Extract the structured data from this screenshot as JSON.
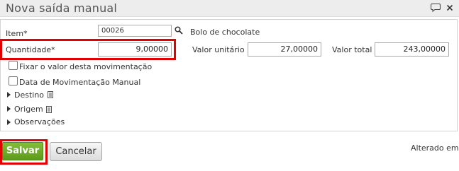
{
  "dialog": {
    "title": "Nova saída manual",
    "icons": [
      "speech-bubble-icon",
      "close-icon"
    ]
  },
  "form": {
    "item_label": "Item*",
    "item_code": "00026",
    "item_description": "Bolo de chocolate",
    "quantidade_label": "Quantidade*",
    "quantidade_value": "9,00000",
    "valor_unitario_label": "Valor unitário",
    "valor_unitario_value": "27,00000",
    "valor_total_label": "Valor total",
    "valor_total_value": "243,00000",
    "fixar_label": "Fixar o valor desta movimentação",
    "fixar_checked": false,
    "data_mov_label": "Data de Movimentação Manual",
    "data_mov_checked": false,
    "sections": [
      "Destino",
      "Origem",
      "Observações"
    ]
  },
  "footer": {
    "save_label": "Salvar",
    "cancel_label": "Cancelar",
    "status_text": "Alterado em"
  },
  "colors": {
    "accent_green": "#6aa823",
    "highlight_red": "#e00000"
  }
}
